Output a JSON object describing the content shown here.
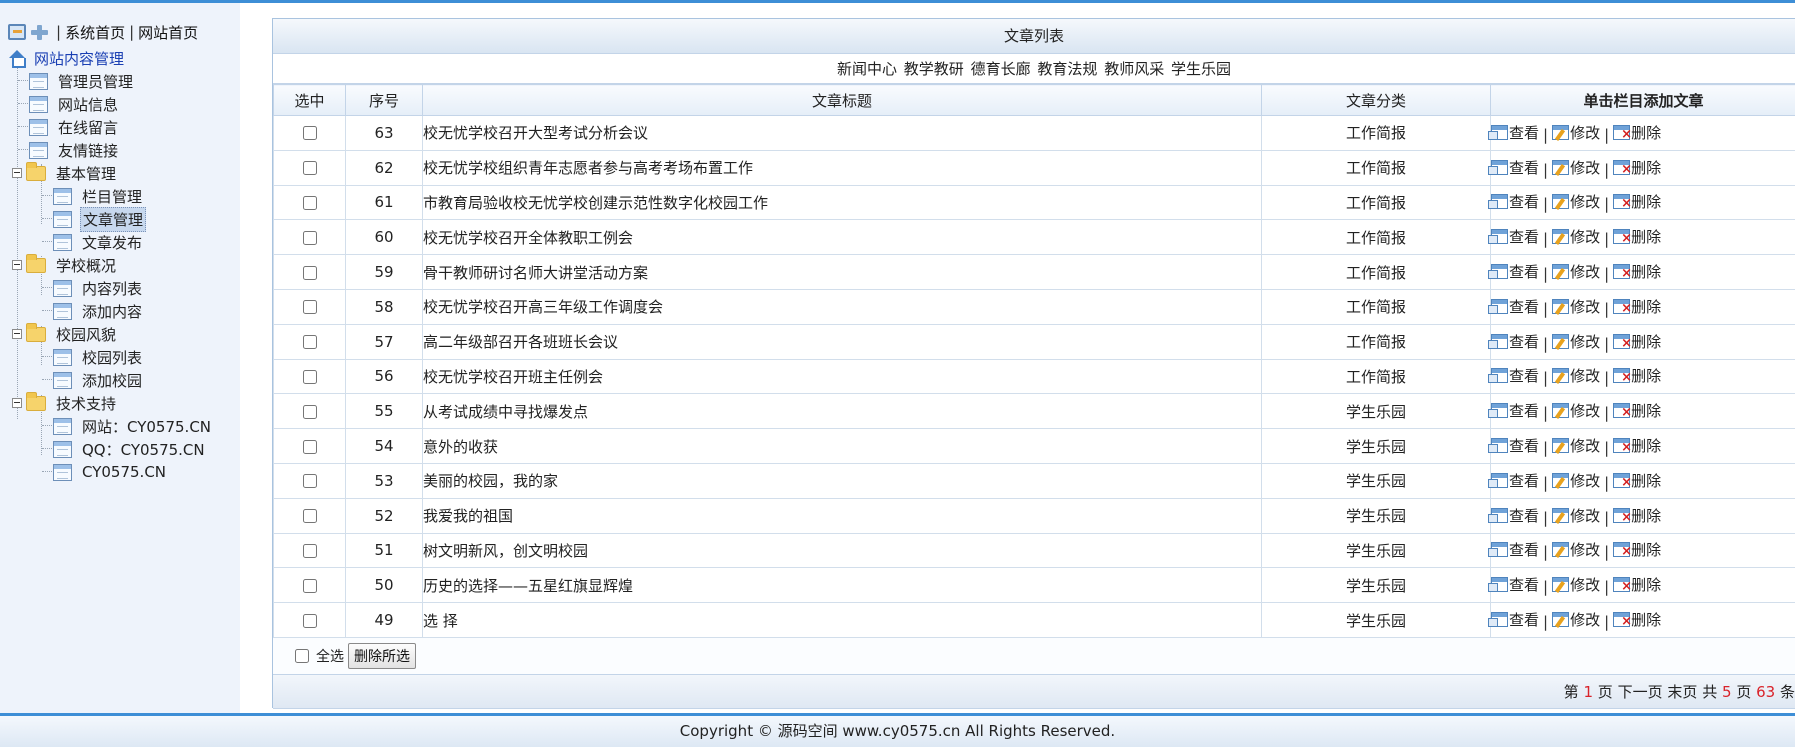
{
  "toolbar": {
    "home_link": "系统首页",
    "site_link": "网站首页",
    "separator": "|"
  },
  "tree": {
    "root": "网站内容管理",
    "items": [
      {
        "label": "管理员管理"
      },
      {
        "label": "网站信息"
      },
      {
        "label": "在线留言"
      },
      {
        "label": "友情链接"
      },
      {
        "label": "基本管理"
      },
      {
        "label": "栏目管理"
      },
      {
        "label": "文章管理"
      },
      {
        "label": "文章发布"
      },
      {
        "label": "学校概况"
      },
      {
        "label": "内容列表"
      },
      {
        "label": "添加内容"
      },
      {
        "label": "校园风貌"
      },
      {
        "label": "校园列表"
      },
      {
        "label": "添加校园"
      },
      {
        "label": "技术支持"
      },
      {
        "label": "网站：CY0575.CN"
      },
      {
        "label": "QQ：CY0575.CN"
      },
      {
        "label": "CY0575.CN"
      }
    ]
  },
  "panel": {
    "title": "文章列表"
  },
  "categories": [
    "新闻中心",
    "教学教研",
    "德育长廊",
    "教育法规",
    "教师风采",
    "学生乐园"
  ],
  "table": {
    "headers": {
      "select": "选中",
      "number": "序号",
      "title": "文章标题",
      "category": "文章分类",
      "actions": "单击栏目添加文章"
    },
    "action_labels": {
      "view": "查看",
      "edit": "修改",
      "delete": "删除",
      "separator": "|"
    },
    "rows": [
      {
        "id": "63",
        "title": "校无忧学校召开大型考试分析会议",
        "category": "工作简报"
      },
      {
        "id": "62",
        "title": "校无忧学校组织青年志愿者参与高考考场布置工作",
        "category": "工作简报"
      },
      {
        "id": "61",
        "title": "市教育局验收校无忧学校创建示范性数字化校园工作",
        "category": "工作简报"
      },
      {
        "id": "60",
        "title": "校无忧学校召开全体教职工例会",
        "category": "工作简报"
      },
      {
        "id": "59",
        "title": "骨干教师研讨名师大讲堂活动方案",
        "category": "工作简报"
      },
      {
        "id": "58",
        "title": "校无忧学校召开高三年级工作调度会",
        "category": "工作简报"
      },
      {
        "id": "57",
        "title": "高二年级部召开各班班长会议",
        "category": "工作简报"
      },
      {
        "id": "56",
        "title": "校无忧学校召开班主任例会",
        "category": "工作简报"
      },
      {
        "id": "55",
        "title": "从考试成绩中寻找爆发点",
        "category": "学生乐园"
      },
      {
        "id": "54",
        "title": "意外的收获",
        "category": "学生乐园"
      },
      {
        "id": "53",
        "title": "美丽的校园，我的家",
        "category": "学生乐园"
      },
      {
        "id": "52",
        "title": "我爱我的祖国",
        "category": "学生乐园"
      },
      {
        "id": "51",
        "title": "树文明新风，创文明校园",
        "category": "学生乐园"
      },
      {
        "id": "50",
        "title": "历史的选择——五星红旗显辉煌",
        "category": "学生乐园"
      },
      {
        "id": "49",
        "title": "选 择",
        "category": "学生乐园"
      }
    ]
  },
  "bulk": {
    "select_all_label": "全选",
    "delete_selected_label": "删除所选"
  },
  "pager": {
    "prefix": "第",
    "current_page": "1",
    "page_unit": "页",
    "next": "下一页",
    "last": "末页",
    "total_prefix": "共",
    "total_pages": "5",
    "total_pages_unit": "页",
    "total_items": "63",
    "total_items_unit": "条"
  },
  "footer": {
    "copyright": "Copyright © 源码空间 www.cy0575.cn All Rights Reserved."
  },
  "colors": {
    "accent": "#3d8ed6",
    "sidebar_bg": "#eef3fb",
    "pager_highlight": "#d9232a",
    "root_link": "#1a3fb3"
  }
}
